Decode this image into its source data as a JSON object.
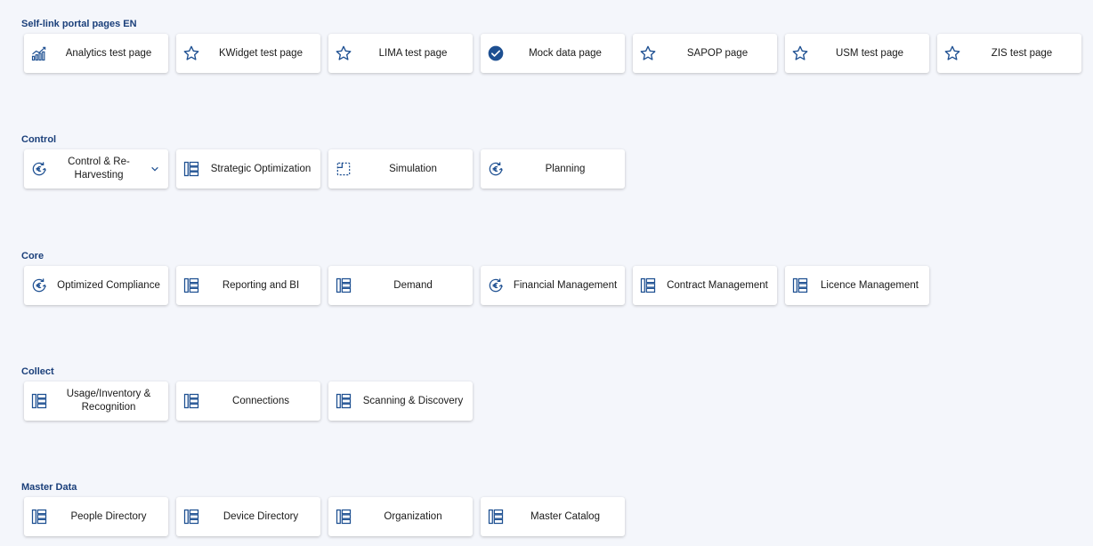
{
  "sections": [
    {
      "title": "Self-link portal pages EN",
      "tiles": [
        {
          "label": "Analytics test page",
          "icon": "analytics-chart-icon"
        },
        {
          "label": "KWidget test page",
          "icon": "star-icon"
        },
        {
          "label": "LIMA test page",
          "icon": "star-icon"
        },
        {
          "label": "Mock data page",
          "icon": "check-circle-icon"
        },
        {
          "label": "SAPOP page",
          "icon": "star-icon"
        },
        {
          "label": "USM test page",
          "icon": "star-icon"
        },
        {
          "label": "ZIS test page",
          "icon": "star-icon"
        }
      ]
    },
    {
      "title": "Control",
      "tiles": [
        {
          "label": "Control & Re-Harvesting",
          "icon": "euro-cycle-icon",
          "expandable": true
        },
        {
          "label": "Strategic Optimization",
          "icon": "list-panel-icon"
        },
        {
          "label": "Simulation",
          "icon": "dashed-square-icon"
        },
        {
          "label": "Planning",
          "icon": "euro-cycle-icon"
        }
      ]
    },
    {
      "title": "Core",
      "tiles": [
        {
          "label": "Optimized Compliance",
          "icon": "euro-cycle-icon"
        },
        {
          "label": "Reporting and BI",
          "icon": "list-panel-icon"
        },
        {
          "label": "Demand",
          "icon": "list-panel-icon"
        },
        {
          "label": "Financial Management",
          "icon": "euro-cycle-icon"
        },
        {
          "label": "Contract Management",
          "icon": "list-panel-icon"
        },
        {
          "label": "Licence Management",
          "icon": "list-panel-icon"
        }
      ]
    },
    {
      "title": "Collect",
      "tiles": [
        {
          "label": "Usage/Inventory & Recognition",
          "icon": "list-panel-icon"
        },
        {
          "label": "Connections",
          "icon": "list-panel-icon"
        },
        {
          "label": "Scanning & Discovery",
          "icon": "list-panel-icon"
        }
      ]
    },
    {
      "title": "Master Data",
      "tiles": [
        {
          "label": "People Directory",
          "icon": "list-panel-icon"
        },
        {
          "label": "Device Directory",
          "icon": "list-panel-icon"
        },
        {
          "label": "Organization",
          "icon": "list-panel-icon"
        },
        {
          "label": "Master Catalog",
          "icon": "list-panel-icon"
        }
      ]
    }
  ],
  "colors": {
    "accent": "#1d4f91",
    "heading": "#1a3f7a",
    "background": "#f4f6fb",
    "tile": "#ffffff"
  }
}
